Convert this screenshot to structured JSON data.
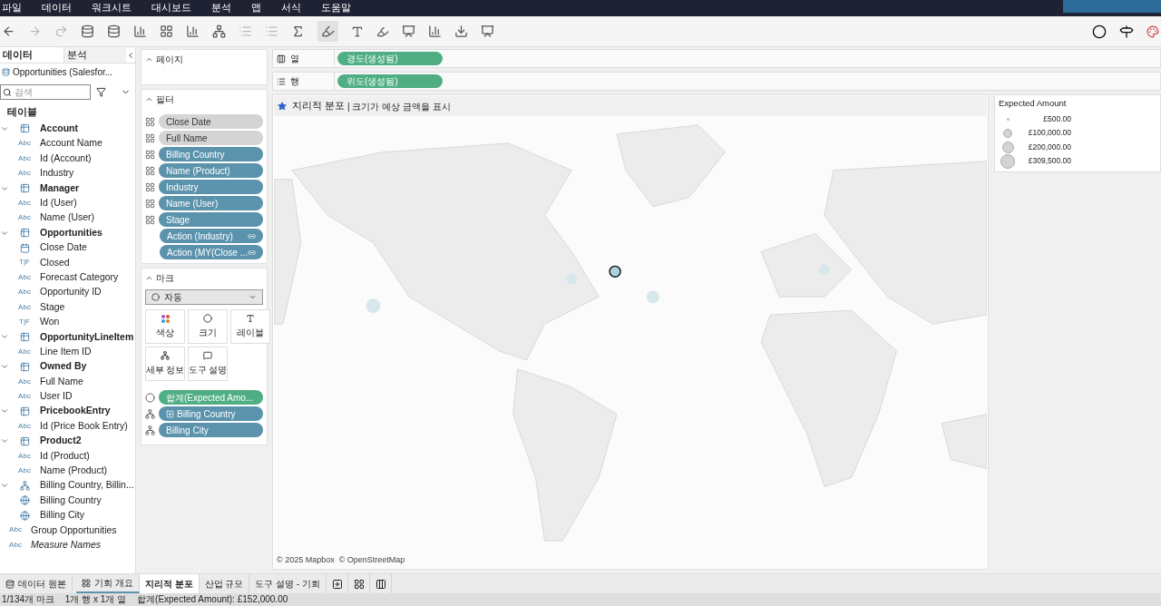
{
  "menu": [
    "파일",
    "데이터",
    "워크시트",
    "대시보드",
    "분석",
    "맵",
    "서식",
    "도움말"
  ],
  "side_tabs": [
    {
      "label": "데이터",
      "selected": true
    },
    {
      "label": "분석",
      "selected": false
    }
  ],
  "data_source": "Opportunities (Salesfor...",
  "search": {
    "placeholder": "검색"
  },
  "tables_heading": "테이블",
  "tree": [
    {
      "kind": "table",
      "name": "Account",
      "expanded": true,
      "children": [
        {
          "kind": "field",
          "badge": "Abc",
          "name": "Account Name"
        },
        {
          "kind": "field",
          "badge": "Abc",
          "name": "Id (Account)"
        },
        {
          "kind": "field",
          "badge": "Abc",
          "name": "Industry"
        }
      ]
    },
    {
      "kind": "table",
      "name": "Manager",
      "expanded": true,
      "children": [
        {
          "kind": "field",
          "badge": "Abc",
          "name": "Id (User)"
        },
        {
          "kind": "field",
          "badge": "Abc",
          "name": "Name (User)"
        }
      ]
    },
    {
      "kind": "table",
      "name": "Opportunities",
      "expanded": true,
      "children": [
        {
          "kind": "date",
          "name": "Close Date"
        },
        {
          "kind": "field",
          "badge": "T|F",
          "name": "Closed"
        },
        {
          "kind": "field",
          "badge": "Abc",
          "name": "Forecast Category"
        },
        {
          "kind": "field",
          "badge": "Abc",
          "name": "Opportunity ID"
        },
        {
          "kind": "field",
          "badge": "Abc",
          "name": "Stage"
        },
        {
          "kind": "field",
          "badge": "T|F",
          "name": "Won"
        }
      ]
    },
    {
      "kind": "table",
      "name": "OpportunityLineItem",
      "expanded": true,
      "children": [
        {
          "kind": "field",
          "badge": "Abc",
          "name": "Line Item ID"
        }
      ]
    },
    {
      "kind": "table",
      "name": "Owned By",
      "expanded": true,
      "children": [
        {
          "kind": "field",
          "badge": "Abc",
          "name": "Full Name"
        },
        {
          "kind": "field",
          "badge": "Abc",
          "name": "User ID"
        }
      ]
    },
    {
      "kind": "table",
      "name": "PricebookEntry",
      "expanded": true,
      "children": [
        {
          "kind": "field",
          "badge": "Abc",
          "name": "Id (Price Book Entry)"
        }
      ]
    },
    {
      "kind": "table",
      "name": "Product2",
      "expanded": true,
      "children": [
        {
          "kind": "field",
          "badge": "Abc",
          "name": "Id (Product)"
        },
        {
          "kind": "field",
          "badge": "Abc",
          "name": "Name (Product)"
        }
      ]
    },
    {
      "kind": "hierarchy",
      "name": "Billing Country, Billin...",
      "expanded": true,
      "children": [
        {
          "kind": "geo",
          "name": "Billing Country"
        },
        {
          "kind": "geo",
          "name": "Billing City"
        }
      ]
    },
    {
      "kind": "group",
      "badge": "Abc",
      "name": "Group Opportunities"
    },
    {
      "kind": "measure_names",
      "badge": "Abc",
      "name": "Measure Names"
    }
  ],
  "pages_card": {
    "title": "페이지"
  },
  "filters_card": {
    "title": "필터",
    "pills": [
      {
        "kind": "inactive",
        "label": "Close Date"
      },
      {
        "kind": "inactive",
        "label": "Full Name"
      },
      {
        "kind": "dimension",
        "label": "Billing Country"
      },
      {
        "kind": "dimension",
        "label": "Name (Product)"
      },
      {
        "kind": "dimension",
        "label": "Industry"
      },
      {
        "kind": "dimension",
        "label": "Name (User)"
      },
      {
        "kind": "dimension",
        "label": "Stage"
      },
      {
        "kind": "action",
        "label": "Action (Industry)"
      },
      {
        "kind": "action",
        "label": "Action (MY(Close ..."
      }
    ]
  },
  "marks_card": {
    "title": "마크",
    "mark_type": "자동",
    "buttons": [
      {
        "kind": "color",
        "label": "색상"
      },
      {
        "kind": "size",
        "label": "크기"
      },
      {
        "kind": "label",
        "label": "레이블"
      },
      {
        "kind": "detail",
        "label": "세부 정보"
      },
      {
        "kind": "tooltip",
        "label": "도구 설명"
      }
    ],
    "pills": [
      {
        "kind": "size",
        "color": "#4fae84",
        "collapse": false,
        "label": "합계(Expected Amo..."
      },
      {
        "kind": "detail",
        "color": "#5b93ad",
        "collapse": true,
        "label": "Billing Country"
      },
      {
        "kind": "detail",
        "color": "#5b93ad",
        "collapse": false,
        "label": "Billing City"
      }
    ]
  },
  "shelves": [
    {
      "kind": "columns",
      "label": "열",
      "pill": "경도(생성됨)"
    },
    {
      "kind": "rows",
      "label": "행",
      "pill": "위도(생성됨)"
    }
  ],
  "view": {
    "title": "지리적 분포",
    "subtitle": "| 크기가 예상 금액을 표시",
    "attribution": "© 2025 Mapbox  © OpenStreetMap"
  },
  "legend": {
    "title": "Expected Amount",
    "items": [
      "£500.00",
      "£100,000.00",
      "£200,000.00",
      "£309,500.00"
    ]
  },
  "sheet_tabs": [
    {
      "kind": "datasource",
      "label": "데이터 원본",
      "selected": false
    },
    {
      "kind": "dashboard",
      "label": "기회 개요",
      "selected": false
    },
    {
      "kind": "sheet",
      "label": "지리적 분포",
      "selected": true
    },
    {
      "kind": "sheet",
      "label": "산업 규모",
      "selected": false
    },
    {
      "kind": "sheet",
      "label": "도구 설명 - 기회",
      "selected": false
    }
  ],
  "status": [
    "1/134개 마크",
    "1개 행 x 1개 열",
    "합계(Expected Amount): £152,000.00"
  ]
}
